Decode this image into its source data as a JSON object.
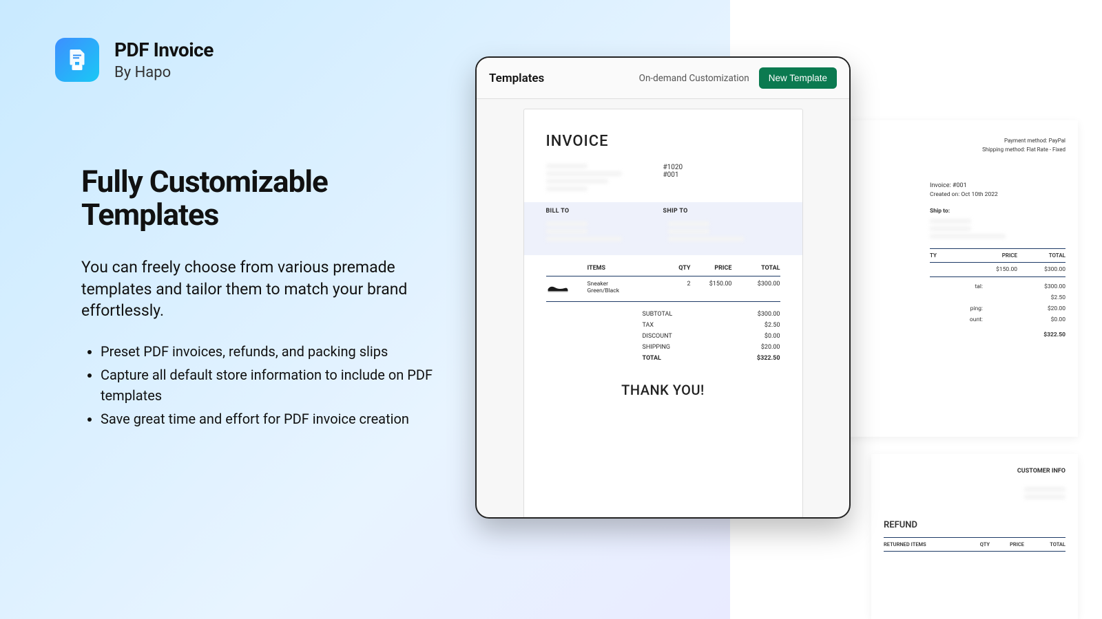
{
  "app": {
    "name": "PDF Invoice",
    "by": "By Hapo"
  },
  "copy": {
    "headline": "Fully Customizable Templates",
    "subhead": "You can freely choose from various premade templates and tailor them to match your brand effortlessly.",
    "bullets": [
      "Preset PDF invoices, refunds, and packing slips",
      "Capture all default store information to include on PDF templates",
      "Save great time and effort for PDF invoice creation"
    ]
  },
  "panel": {
    "title": "Templates",
    "customization_link": "On-demand Customization",
    "new_template_button": "New Template"
  },
  "invoice": {
    "title": "INVOICE",
    "order_no": "#1020",
    "inv_no": "#001",
    "bill_to_label": "BILL TO",
    "ship_to_label": "SHIP TO",
    "headers": {
      "items": "ITEMS",
      "qty": "QTY",
      "price": "PRICE",
      "total": "TOTAL"
    },
    "lines": [
      {
        "desc_a": "Sneaker",
        "desc_b": "Green/Black",
        "qty": "2",
        "price": "$150.00",
        "total": "$300.00"
      }
    ],
    "totals": {
      "subtotal_label": "SUBTOTAL",
      "subtotal": "$300.00",
      "tax_label": "TAX",
      "tax": "$2.50",
      "discount_label": "DISCOUNT",
      "discount": "$0.00",
      "shipping_label": "SHIPPING",
      "shipping": "$20.00",
      "total_label": "TOTAL",
      "total": "$322.50"
    },
    "thank_you": "THANK YOU!"
  },
  "bg_invoice": {
    "payment_method": "Payment method: PayPal",
    "shipping_method": "Shipping method: Flat Rate - Fixed",
    "inv_no": "Invoice: #001",
    "created": "Created on: Oct 10th 2022",
    "ship_to_label": "Ship to:",
    "headers": {
      "qty": "TY",
      "price": "PRICE",
      "total": "TOTAL"
    },
    "row": {
      "price": "$150.00",
      "total": "$300.00"
    },
    "totals": {
      "subtotal_label": "tal:",
      "subtotal": "$300.00",
      "tax_label": "",
      "tax": "$2.50",
      "shipping_label": "ping:",
      "shipping": "$20.00",
      "discount_label": "ount:",
      "discount": "$0.00",
      "total_label": "",
      "total": "$322.50"
    }
  },
  "bg_refund": {
    "customer_info_label": "CUSTOMER INFO",
    "title": "REFUND",
    "headers": {
      "items": "RETURNED ITEMS",
      "qty": "QTY",
      "price": "PRICE",
      "total": "TOTAL"
    }
  }
}
